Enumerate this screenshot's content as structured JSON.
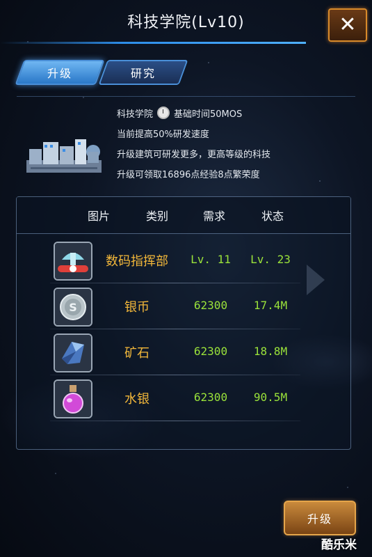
{
  "header": {
    "title": "科技学院(Lv10)",
    "close_icon": "close-icon"
  },
  "tabs": [
    {
      "label": "升级",
      "active": true
    },
    {
      "label": "研究",
      "active": false
    }
  ],
  "info": {
    "line1_name": "科技学院",
    "line1_time": "基础时间50MOS",
    "line2": "当前提高50%研发速度",
    "line3": "升级建筑可研发更多，更高等级的科技",
    "line4": "升级可领取16896点经验8点繁荣度"
  },
  "table": {
    "headers": [
      "图片",
      "类别",
      "需求",
      "状态"
    ],
    "rows": [
      {
        "icon": "digimon-command-icon",
        "type": "数码指挥部",
        "requirement": "Lv. 11",
        "status": "Lv. 23"
      },
      {
        "icon": "silver-coin-icon",
        "type": "银币",
        "requirement": "62300",
        "status": "17.4M"
      },
      {
        "icon": "ore-icon",
        "type": "矿石",
        "requirement": "62300",
        "status": "18.8M"
      },
      {
        "icon": "mercury-icon",
        "type": "水银",
        "requirement": "62300",
        "status": "90.5M"
      }
    ]
  },
  "upgrade_button": "升级",
  "watermark": "酷乐米",
  "colors": {
    "accent": "#2d8de8",
    "gold_text": "#f2b73a",
    "green_text": "#9ae23a",
    "button": "#c98a3c"
  }
}
